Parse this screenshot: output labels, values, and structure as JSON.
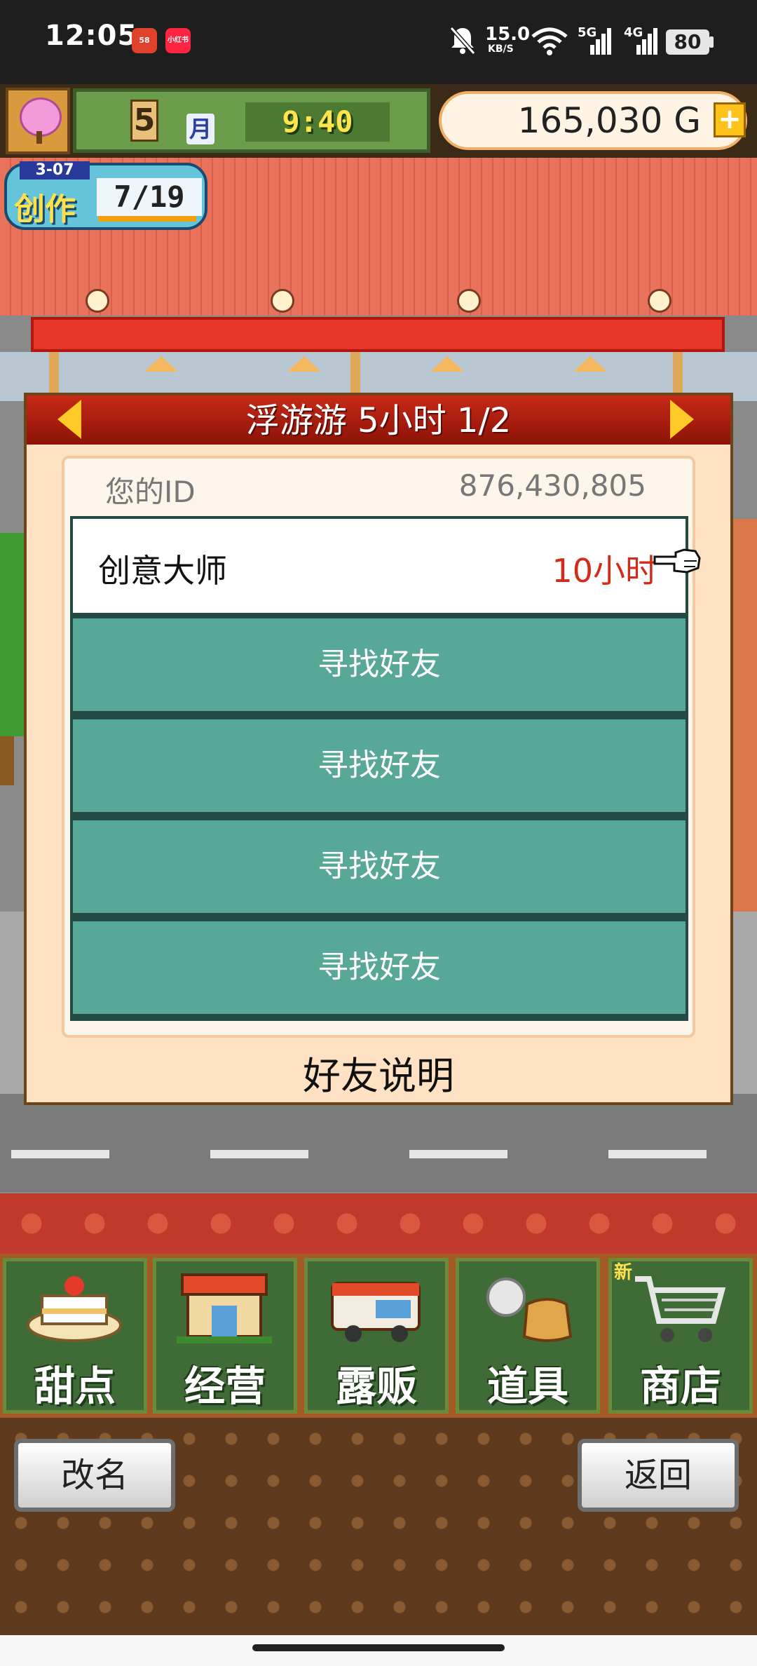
{
  "status_bar": {
    "time": "12:05",
    "app_badge_1": "58",
    "app_badge_2": "小红书",
    "net_speed": "15.0",
    "net_unit": "KB/S",
    "sig1": "5G",
    "sig2": "4G",
    "battery": "80"
  },
  "hud": {
    "month_number": "5",
    "month_label": "月",
    "clock": "9:40",
    "money": "165,030",
    "currency": "G",
    "plus": "+"
  },
  "creation": {
    "level": "3-07",
    "label": "创作",
    "count": "7/19"
  },
  "dialog": {
    "title": "浮游游  5小时 1/2",
    "your_id_label": "您的ID",
    "your_id_value": "876,430,805",
    "friend_row": {
      "name": "创意大师",
      "time": "10小时"
    },
    "find_friend_rows": [
      "寻找好友",
      "寻找好友",
      "寻找好友",
      "寻找好友"
    ],
    "friend_help": "好友说明"
  },
  "nav_tabs": [
    {
      "label": "甜点",
      "icon": "cake-icon"
    },
    {
      "label": "经营",
      "icon": "shop-icon"
    },
    {
      "label": "露贩",
      "icon": "food-truck-icon"
    },
    {
      "label": "道具",
      "icon": "item-bag-icon"
    },
    {
      "label": "商店",
      "icon": "cart-icon",
      "badge": "新"
    }
  ],
  "buttons": {
    "rename": "改名",
    "back": "返回"
  },
  "colors": {
    "dialog_header": "#b3200f",
    "list_teal": "#58a898",
    "time_red": "#d42a1a",
    "nav_green": "#3f6b36",
    "money_panel": "#fff4e4"
  }
}
